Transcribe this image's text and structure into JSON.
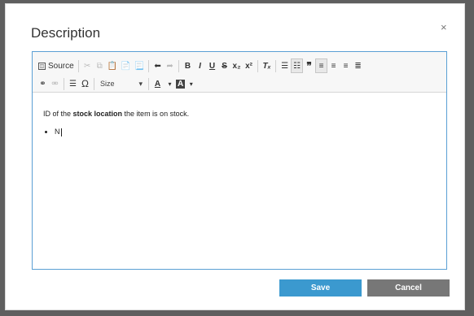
{
  "dialog": {
    "title": "Description",
    "close_glyph": "×"
  },
  "toolbar": {
    "source_label": "Source",
    "size_label": "Size",
    "bold": "B",
    "italic": "I",
    "underline": "U",
    "strike": "S",
    "subscript": "x₂",
    "superscript": "x²",
    "remove_format": "Tₓ",
    "quote": "❞",
    "text_color": "A",
    "bg_color": "A",
    "special_char": "Ω",
    "undo": "⬅",
    "redo": "➦"
  },
  "content": {
    "line1_prefix": "ID of the ",
    "line1_bold": "stock location",
    "line1_suffix": " the item is on stock.",
    "bullet": "N"
  },
  "buttons": {
    "save": "Save",
    "cancel": "Cancel"
  },
  "colors": {
    "editor_border": "#5a9fd4",
    "save_bg": "#3b99cf",
    "cancel_bg": "#777777",
    "overlay": "#5f5f5f"
  }
}
